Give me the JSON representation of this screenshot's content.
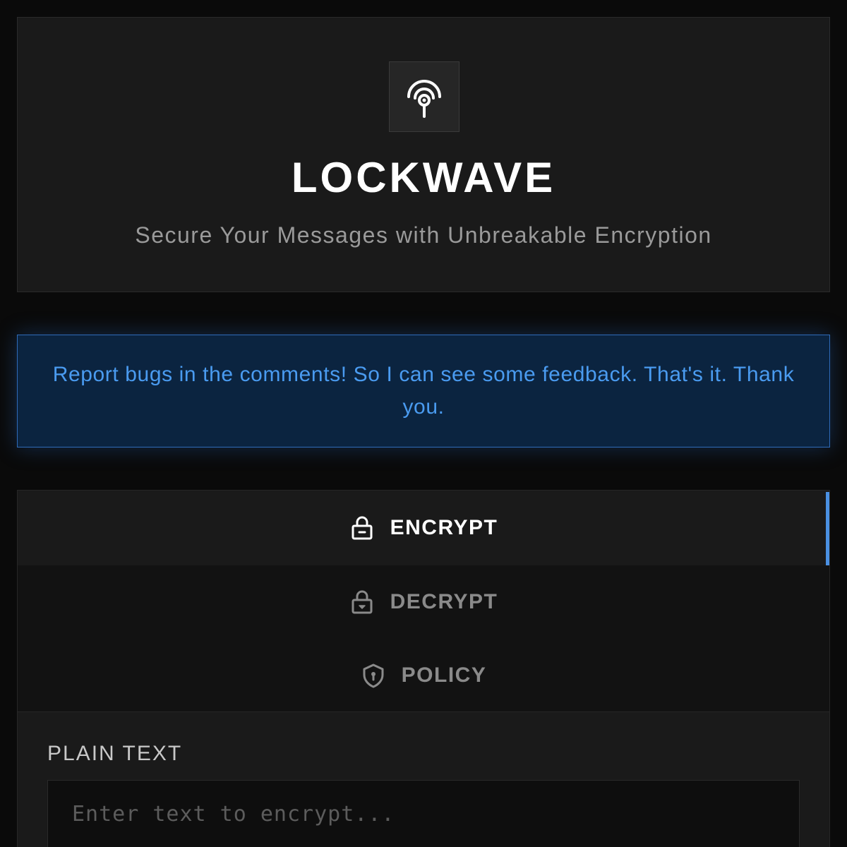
{
  "header": {
    "logo_icon": "broadcast-lock-icon",
    "title": "LOCKWAVE",
    "subtitle": "Secure Your Messages with Unbreakable Encryption"
  },
  "notice": {
    "text": "Report bugs in the comments! So I can see some feedback. That's it. Thank you."
  },
  "tabs": [
    {
      "label": "ENCRYPT",
      "icon": "lock-icon",
      "active": true
    },
    {
      "label": "DECRYPT",
      "icon": "unlock-icon",
      "active": false
    },
    {
      "label": "POLICY",
      "icon": "shield-icon",
      "active": false
    }
  ],
  "encrypt": {
    "field_label": "PLAIN TEXT",
    "placeholder": "Enter text to encrypt...",
    "value": ""
  },
  "colors": {
    "accent": "#4a90e2",
    "notice_bg": "#0b2440",
    "notice_text": "#4a9bf0",
    "page_bg": "#0a0a0a"
  }
}
